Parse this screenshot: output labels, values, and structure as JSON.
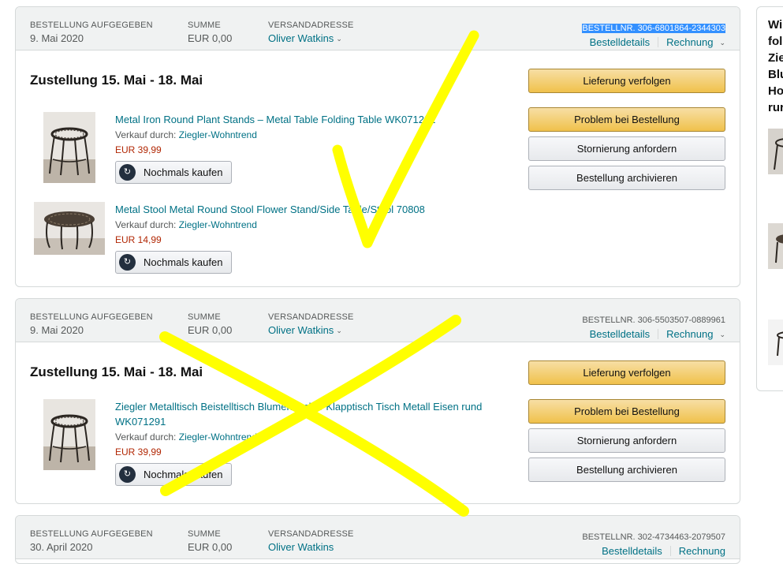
{
  "orders": [
    {
      "placed_label": "BESTELLUNG AUFGEGEBEN",
      "placed_date": "9. Mai 2020",
      "total_label": "SUMME",
      "total_value": "EUR 0,00",
      "address_label": "VERSANDADRESSE",
      "address_name": "Oliver Watkins",
      "order_number": "BESTELLNR. 306-6801864-2344303",
      "details_link": "Bestelldetails",
      "invoice_link": "Rechnung",
      "delivery": "Zustellung 15. Mai - 18. Mai",
      "items": [
        {
          "title": "Metal Iron Round Plant Stands – Metal Table Folding Table WK071291",
          "seller_prefix": "Verkauf durch:",
          "seller": "Ziegler-Wohntrend",
          "price": "EUR 39,99",
          "rebuy": "Nochmals kaufen"
        },
        {
          "title": "Metal Stool Metal Round Stool Flower Stand/Side Table/Stool 70808",
          "seller_prefix": "Verkauf durch:",
          "seller": "Ziegler-Wohntrend",
          "price": "EUR 14,99",
          "rebuy": "Nochmals kaufen"
        }
      ],
      "actions": {
        "track": "Lieferung verfolgen",
        "problem": "Problem bei Bestellung",
        "cancel": "Stornierung anfordern",
        "archive": "Bestellung archivieren"
      }
    },
    {
      "placed_label": "BESTELLUNG AUFGEGEBEN",
      "placed_date": "9. Mai 2020",
      "total_label": "SUMME",
      "total_value": "EUR 0,00",
      "address_label": "VERSANDADRESSE",
      "address_name": "Oliver Watkins",
      "order_number": "BESTELLNR. 306-5503507-0889961",
      "details_link": "Bestelldetails",
      "invoice_link": "Rechnung",
      "delivery": "Zustellung 15. Mai - 18. Mai",
      "items": [
        {
          "title": "Ziegler Metalltisch Beistelltisch Blumenhocker Klapptisch Tisch Metall Eisen rund WK071291",
          "seller_prefix": "Verkauf durch:",
          "seller": "Ziegler-Wohntrend",
          "price": "EUR 39,99",
          "rebuy": "Nochmals kaufen"
        }
      ],
      "actions": {
        "track": "Lieferung verfolgen",
        "problem": "Problem bei Bestellung",
        "cancel": "Stornierung anfordern",
        "archive": "Bestellung archivieren"
      }
    },
    {
      "placed_label": "BESTELLUNG AUFGEGEBEN",
      "placed_date": "30. April 2020",
      "total_label": "SUMME",
      "total_value": "EUR 0,00",
      "address_label": "VERSANDADRESSE",
      "address_name": "Oliver Watkins",
      "order_number": "BESTELLNR. 302-4734463-2079507",
      "details_link": "Bestelldetails",
      "invoice_link": "Rechnung"
    }
  ],
  "side_panel": {
    "title_fragment": "Wi\nfol\nZie\nBlu\nHo\nrur"
  },
  "icons": {
    "caret": "chevron-down-icon",
    "rebuy": "rebuy-icon"
  },
  "colors": {
    "link": "#007185",
    "price": "#b12704",
    "button_primary": "#f0c14b",
    "annotation": "#ffff00",
    "selection": "#3390ff"
  }
}
